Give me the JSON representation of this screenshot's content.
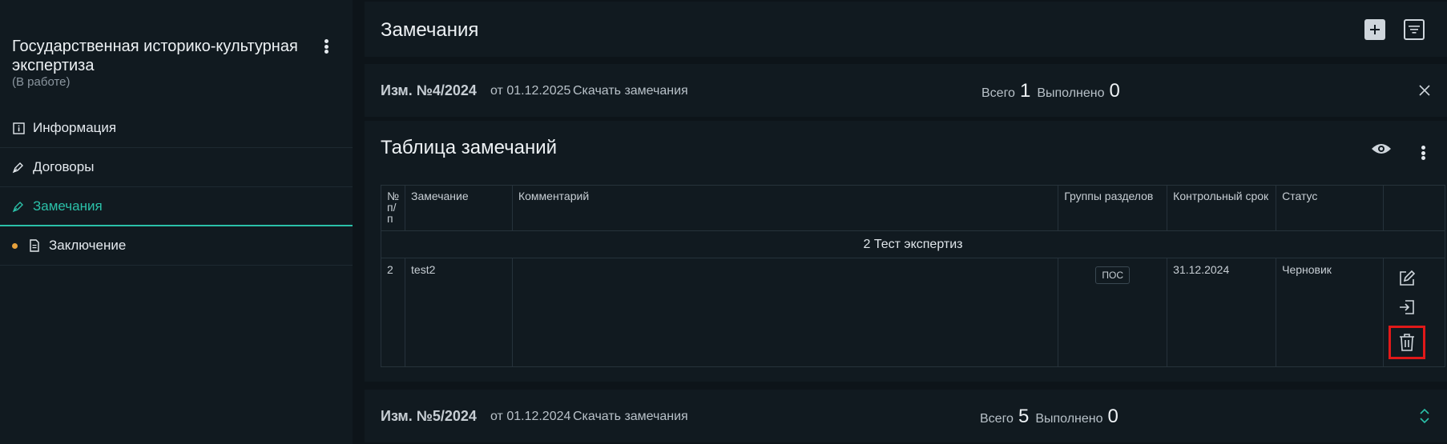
{
  "sidebar": {
    "title": "Государственная историко-культурная экспертиза",
    "status": "(В работе)",
    "items": [
      {
        "label": "Информация",
        "icon": "info-icon",
        "active": false
      },
      {
        "label": "Договоры",
        "icon": "pen-icon",
        "active": false
      },
      {
        "label": "Замечания",
        "icon": "pen-icon",
        "active": true
      },
      {
        "label": "Заключение",
        "icon": "document-icon",
        "active": false,
        "dot": true
      }
    ]
  },
  "header": {
    "title": "Замечания",
    "add_icon": "plus-icon",
    "filter_icon": "filter-icon"
  },
  "revisions": [
    {
      "number": "Изм. №4/2024",
      "date": "от 01.12.2025",
      "download": "Скачать замечания",
      "total_label": "Всего",
      "total": "1",
      "done_label": "Выполнено",
      "done": "0",
      "toggle_icon": "close-icon"
    },
    {
      "number": "Изм. №5/2024",
      "date": "от 01.12.2024",
      "download": "Скачать замечания",
      "total_label": "Всего",
      "total": "5",
      "done_label": "Выполнено",
      "done": "0",
      "toggle_icon": "expand-icon"
    }
  ],
  "table": {
    "title": "Таблица замечаний",
    "columns": {
      "num": "№ п/ п",
      "remark": "Замечание",
      "comment": "Комментарий",
      "groups": "Группы разделов",
      "deadline": "Контрольный срок",
      "status": "Статус"
    },
    "group_row": "2 Тест экспертиз",
    "row": {
      "num": "2",
      "remark": "test2",
      "comment": "",
      "group_tag": "ПОС",
      "deadline": "31.12.2024",
      "status": "Черновик"
    }
  },
  "colors": {
    "accent": "#2bc0a8",
    "highlight": "#e11919",
    "dot": "#e8a23c"
  }
}
